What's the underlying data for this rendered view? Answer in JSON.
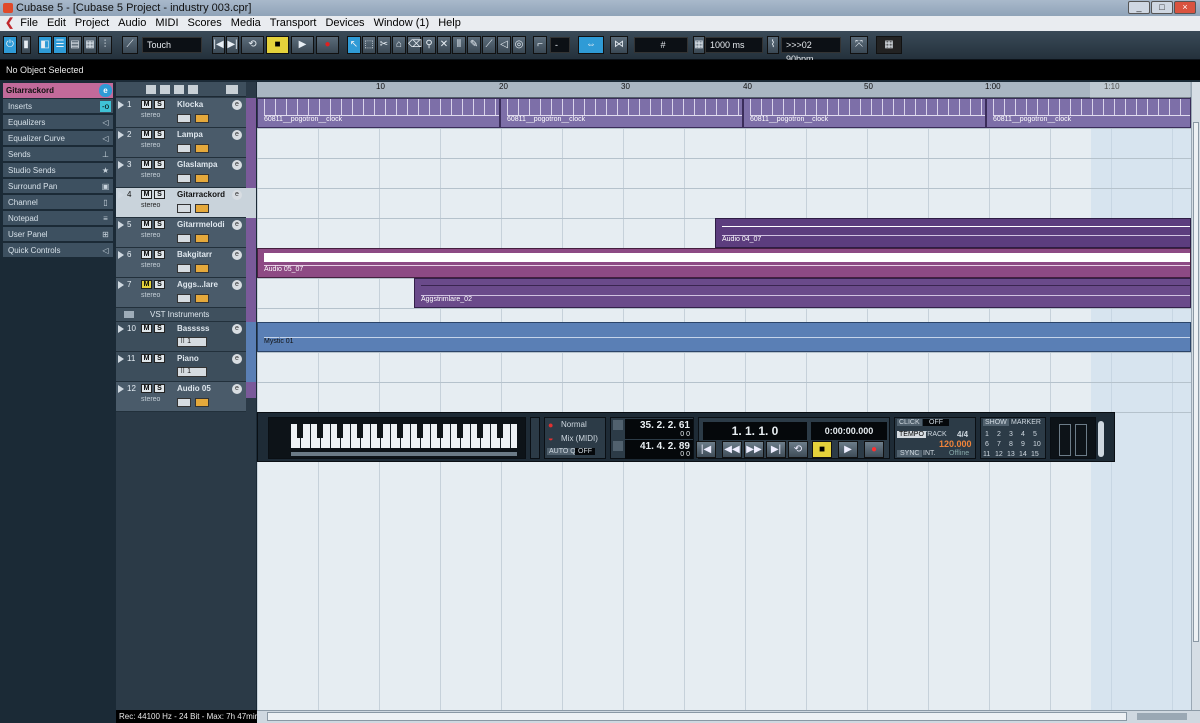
{
  "window": {
    "title": "Cubase 5 - [Cubase 5 Project - industry 003.cpr]"
  },
  "menu": [
    "File",
    "Edit",
    "Project",
    "Audio",
    "MIDI",
    "Scores",
    "Media",
    "Transport",
    "Devices",
    "Window (1)",
    "Help"
  ],
  "toolbar": {
    "automation_mode": "Touch",
    "grid_label": "1000 ms",
    "tempo_label": ">>>02 90bpm",
    "snap_value": "-"
  },
  "info_line": "No Object Selected",
  "inspector": {
    "track_name": "Gitarrackord",
    "items": [
      {
        "label": "Inserts"
      },
      {
        "label": "Equalizers"
      },
      {
        "label": "Equalizer Curve"
      },
      {
        "label": "Sends"
      },
      {
        "label": "Studio Sends"
      },
      {
        "label": "Surround Pan"
      },
      {
        "label": "Channel"
      },
      {
        "label": "Notepad"
      },
      {
        "label": "User Panel"
      },
      {
        "label": "Quick Controls"
      }
    ]
  },
  "tracks": [
    {
      "num": "1",
      "name": "Klocka",
      "sub": "stereo"
    },
    {
      "num": "2",
      "name": "Lampa",
      "sub": "stereo"
    },
    {
      "num": "3",
      "name": "Glaslampa",
      "sub": "stereo"
    },
    {
      "num": "4",
      "name": "Gitarrackord",
      "sub": "stereo"
    },
    {
      "num": "5",
      "name": "Gitarrmelodi",
      "sub": "stereo"
    },
    {
      "num": "6",
      "name": "Bakgitarr",
      "sub": "stereo"
    },
    {
      "num": "7",
      "name": "Aggs...lare",
      "sub": "stereo"
    },
    {
      "num": "",
      "name": "VST Instruments",
      "sub": ""
    },
    {
      "num": "10",
      "name": "Basssss",
      "sub": "1"
    },
    {
      "num": "11",
      "name": "Piano",
      "sub": "1"
    },
    {
      "num": "12",
      "name": "Audio 05",
      "sub": "stereo"
    }
  ],
  "ruler": [
    "10",
    "20",
    "30",
    "40",
    "50",
    "1:00",
    "1:10"
  ],
  "events": [
    {
      "label": "60811__pogotron__clock"
    },
    {
      "label": "60811__pogotron__clock"
    },
    {
      "label": "60811__pogotron__clock"
    },
    {
      "label": "60811__pogotron__clock"
    },
    {
      "label": "Audio 04_07"
    },
    {
      "label": "Audio 05_07"
    },
    {
      "label": "Aggstrimlare_02"
    },
    {
      "label": "Mystic 01"
    }
  ],
  "transport": {
    "rec_mode": "Normal",
    "mix_mode": "Mix (MIDI)",
    "autoq": "AUTO Q",
    "autoq_state": "OFF",
    "left_locator": "35. 2. 2. 61",
    "left_locator_sub": "0   0",
    "right_locator": "41. 4. 2. 89",
    "right_locator_sub": "0   0",
    "position_bars": "1. 1. 1.   0",
    "position_time": "0:00:00.000",
    "click": "CLICK",
    "click_state": "OFF",
    "tempo_btn": "TEMPO",
    "track": "TRACK",
    "signature": "4/4",
    "tempo_value": "120.000",
    "sync": "SYNC",
    "sync_src": "INT.",
    "sync_state": "Offline",
    "show": "SHOW",
    "marker": "MARKER",
    "markers": [
      "1",
      "2",
      "3",
      "4",
      "5",
      "6",
      "7",
      "8",
      "9",
      "10",
      "11",
      "12",
      "13",
      "14",
      "15"
    ]
  },
  "status": "Rec: 44100 Hz - 24 Bit - Max: 7h 47min",
  "colors": {
    "track_purple": "#6a4a8a",
    "track_blue": "#5a7fb5",
    "accent": "#2f9bd6"
  }
}
